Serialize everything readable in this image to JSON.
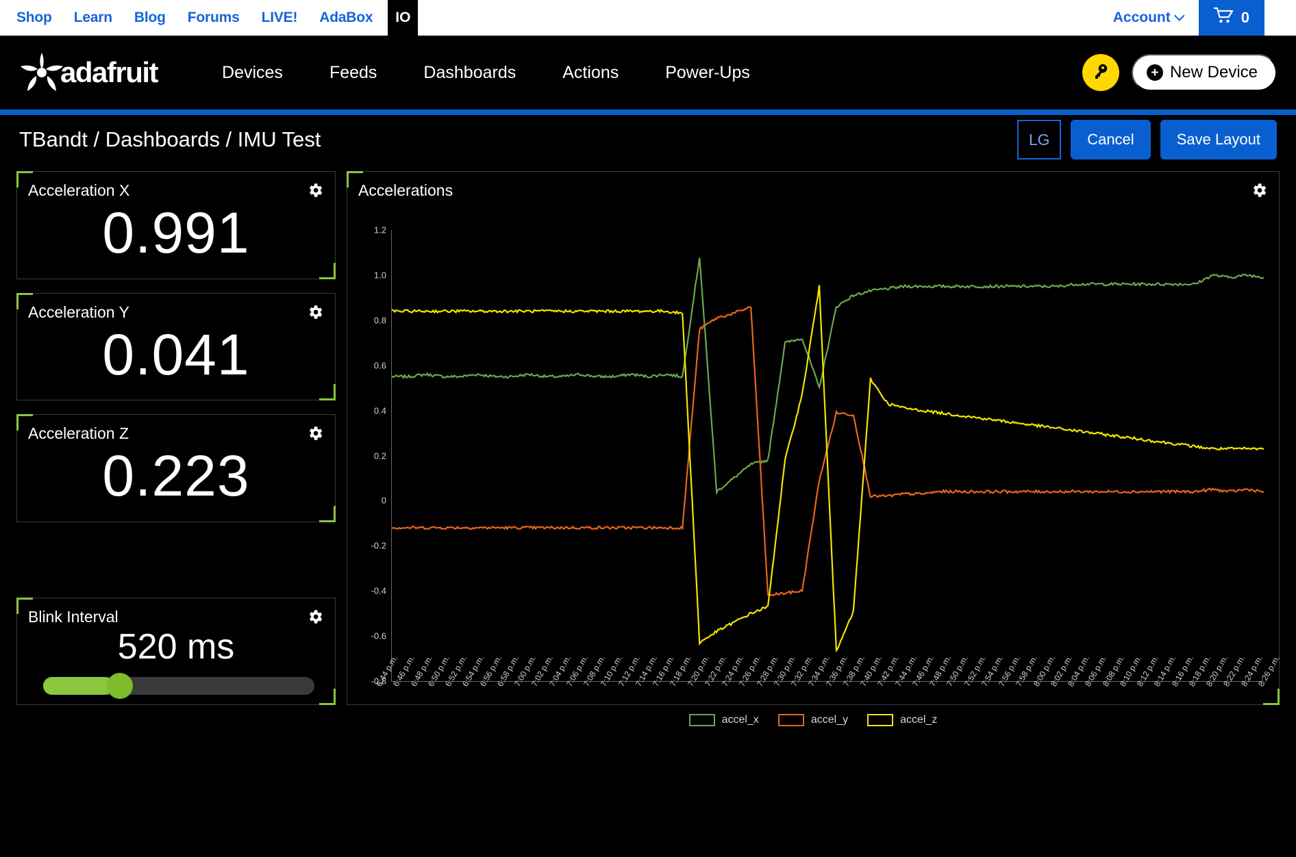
{
  "topbar": {
    "links": [
      {
        "label": "Shop"
      },
      {
        "label": "Learn"
      },
      {
        "label": "Blog"
      },
      {
        "label": "Forums"
      },
      {
        "label": "LIVE!"
      },
      {
        "label": "AdaBox"
      }
    ],
    "io_tab": "IO",
    "account_label": "Account",
    "cart_count": "0"
  },
  "mainnav": {
    "logo_text": "adafruit",
    "links": [
      {
        "label": "Devices"
      },
      {
        "label": "Feeds"
      },
      {
        "label": "Dashboards"
      },
      {
        "label": "Actions"
      },
      {
        "label": "Power-Ups"
      }
    ],
    "new_device_label": "New Device",
    "plus": "+"
  },
  "header": {
    "breadcrumb": "TBandt / Dashboards / IMU Test",
    "size_toggle": "LG",
    "cancel_label": "Cancel",
    "save_label": "Save Layout"
  },
  "sidebar": {
    "gauges": [
      {
        "title": "Acceleration X",
        "value": "0.991"
      },
      {
        "title": "Acceleration Y",
        "value": "0.041"
      },
      {
        "title": "Acceleration Z",
        "value": "0.223"
      }
    ],
    "slider": {
      "title": "Blink Interval",
      "value": "520 ms",
      "fill_percent": 26
    }
  },
  "chart_data": {
    "type": "line",
    "title": "Accelerations",
    "xlabel": "",
    "ylabel": "",
    "ylim": [
      -0.8,
      1.2
    ],
    "yticks": [
      1.2,
      1.0,
      0.8,
      0.6,
      0.4,
      0.2,
      0,
      -0.2,
      -0.4,
      -0.6,
      -0.8
    ],
    "ytick_labels": [
      "1.2",
      "1.0",
      "0.8",
      "0.6",
      "0.4",
      "0.2",
      "0",
      "-0.2",
      "-0.4",
      "-0.6",
      "-0.8"
    ],
    "grid": false,
    "legend_position": "bottom",
    "x": [
      "6:44 p.m.",
      "6:46 p.m.",
      "6:48 p.m.",
      "6:50 p.m.",
      "6:52 p.m.",
      "6:54 p.m.",
      "6:56 p.m.",
      "6:58 p.m.",
      "7:00 p.m.",
      "7:02 p.m.",
      "7:04 p.m.",
      "7:06 p.m.",
      "7:08 p.m.",
      "7:10 p.m.",
      "7:12 p.m.",
      "7:14 p.m.",
      "7:16 p.m.",
      "7:18 p.m.",
      "7:20 p.m.",
      "7:22 p.m.",
      "7:24 p.m.",
      "7:26 p.m.",
      "7:28 p.m.",
      "7:30 p.m.",
      "7:32 p.m.",
      "7:34 p.m.",
      "7:36 p.m.",
      "7:38 p.m.",
      "7:40 p.m.",
      "7:42 p.m.",
      "7:44 p.m.",
      "7:46 p.m.",
      "7:48 p.m.",
      "7:50 p.m.",
      "7:52 p.m.",
      "7:54 p.m.",
      "7:56 p.m.",
      "7:58 p.m.",
      "8:00 p.m.",
      "8:02 p.m.",
      "8:04 p.m.",
      "8:06 p.m.",
      "8:08 p.m.",
      "8:10 p.m.",
      "8:12 p.m.",
      "8:14 p.m.",
      "8:16 p.m.",
      "8:18 p.m.",
      "8:20 p.m.",
      "8:22 p.m.",
      "8:24 p.m.",
      "8:26 p.m."
    ],
    "series": [
      {
        "name": "accel_x",
        "color": "#6aa84f",
        "values": [
          0.55,
          0.55,
          0.56,
          0.55,
          0.55,
          0.56,
          0.55,
          0.55,
          0.56,
          0.55,
          0.55,
          0.56,
          0.55,
          0.55,
          0.56,
          0.55,
          0.56,
          0.55,
          1.08,
          0.04,
          0.1,
          0.16,
          0.18,
          0.7,
          0.72,
          0.5,
          0.86,
          0.91,
          0.93,
          0.94,
          0.95,
          0.95,
          0.95,
          0.95,
          0.95,
          0.95,
          0.95,
          0.95,
          0.95,
          0.95,
          0.96,
          0.96,
          0.96,
          0.96,
          0.96,
          0.96,
          0.96,
          0.96,
          1.0,
          0.99,
          1.0,
          0.99
        ]
      },
      {
        "name": "accel_y",
        "color": "#e8661d",
        "values": [
          -0.12,
          -0.12,
          -0.12,
          -0.12,
          -0.12,
          -0.12,
          -0.12,
          -0.12,
          -0.12,
          -0.12,
          -0.12,
          -0.12,
          -0.12,
          -0.12,
          -0.12,
          -0.12,
          -0.12,
          -0.12,
          0.76,
          0.81,
          0.83,
          0.86,
          -0.42,
          -0.41,
          -0.4,
          0.09,
          0.39,
          0.38,
          0.02,
          0.02,
          0.03,
          0.03,
          0.04,
          0.04,
          0.04,
          0.04,
          0.04,
          0.04,
          0.04,
          0.04,
          0.04,
          0.04,
          0.04,
          0.04,
          0.04,
          0.04,
          0.04,
          0.04,
          0.05,
          0.04,
          0.05,
          0.04
        ]
      },
      {
        "name": "accel_z",
        "color": "#f2e600",
        "values": [
          0.84,
          0.84,
          0.84,
          0.84,
          0.84,
          0.84,
          0.84,
          0.84,
          0.84,
          0.84,
          0.84,
          0.84,
          0.84,
          0.84,
          0.84,
          0.84,
          0.84,
          0.83,
          -0.63,
          -0.58,
          -0.54,
          -0.5,
          -0.47,
          0.18,
          0.47,
          0.95,
          -0.67,
          -0.49,
          0.54,
          0.43,
          0.41,
          0.4,
          0.39,
          0.38,
          0.37,
          0.36,
          0.35,
          0.34,
          0.33,
          0.32,
          0.31,
          0.3,
          0.29,
          0.28,
          0.27,
          0.26,
          0.25,
          0.24,
          0.23,
          0.23,
          0.23,
          0.23
        ]
      }
    ]
  }
}
